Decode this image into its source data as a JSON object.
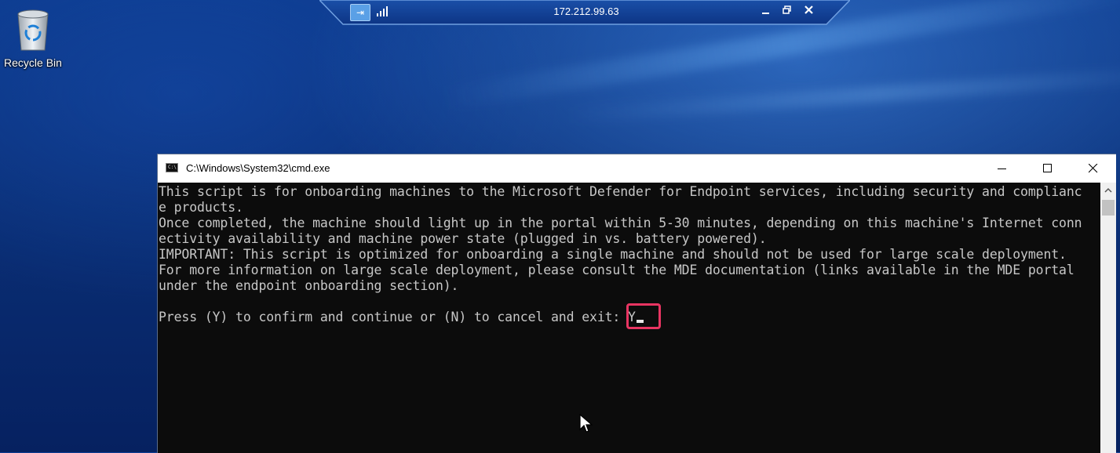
{
  "desktop": {
    "icons": [
      {
        "label": "Recycle Bin",
        "icon": "recycle-bin-icon"
      }
    ]
  },
  "rdp_bar": {
    "title": "172.212.99.63",
    "pin_icon": "pin-icon",
    "signal_icon": "connection-signal-icon",
    "buttons": [
      "minimize",
      "restore",
      "close"
    ]
  },
  "console_window": {
    "title": "C:\\Windows\\System32\\cmd.exe",
    "lines": [
      "This script is for onboarding machines to the Microsoft Defender for Endpoint services, including security and complianc",
      "e products.",
      "Once completed, the machine should light up in the portal within 5-30 minutes, depending on this machine's Internet conn",
      "ectivity availability and machine power state (plugged in vs. battery powered).",
      "IMPORTANT: This script is optimized for onboarding a single machine and should not be used for large scale deployment.",
      "For more information on large scale deployment, please consult the MDE documentation (links available in the MDE portal",
      "under the endpoint onboarding section).",
      ""
    ],
    "prompt": "Press (Y) to confirm and continue or (N) to cancel and exit: ",
    "answer": "Y",
    "highlight_color": "#e83562",
    "text_color": "#c7c7c7",
    "background_color": "#0c0c0c"
  }
}
